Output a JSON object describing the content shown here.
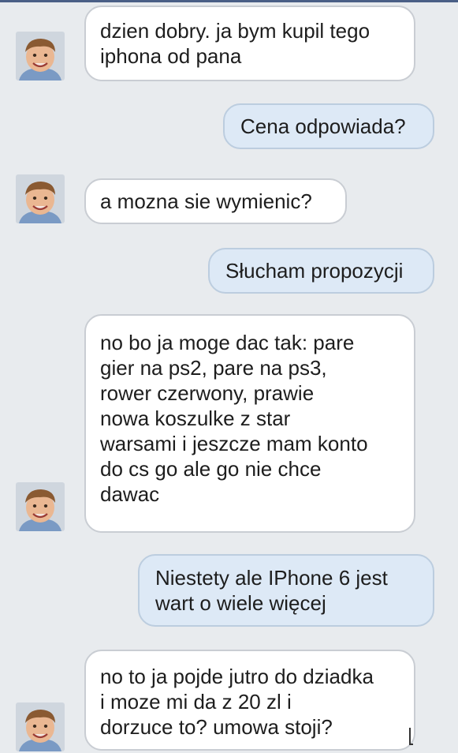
{
  "conversation": {
    "messages": [
      {
        "sender": "other",
        "text": "dzien dobry. ja bym kupil tego\niphona od pana"
      },
      {
        "sender": "me",
        "text": "Cena odpowiada?"
      },
      {
        "sender": "other",
        "text": "a mozna sie wymienic?"
      },
      {
        "sender": "me",
        "text": "Słucham propozycji"
      },
      {
        "sender": "other",
        "text": "no bo ja moge dac tak: pare\ngier na ps2, pare na ps3,\nrower czerwony, prawie\nnowa koszulke z star\nwarsami i jeszcze mam konto\ndo cs go ale go nie chce\ndawac"
      },
      {
        "sender": "me",
        "text": "Niestety ale IPhone 6 jest\nwart o wiele więcej"
      },
      {
        "sender": "other",
        "text": "no to ja pojde jutro do dziadka\ni moze mi da z 20 zl i\ndorzuce to? umowa stoji?"
      }
    ]
  },
  "colors": {
    "background": "#e8ebee",
    "incoming_bubble": "#ffffff",
    "outgoing_bubble": "#dde9f6",
    "top_bar": "#4a5f86"
  },
  "icons": {
    "avatar": "child-avatar-photo"
  }
}
